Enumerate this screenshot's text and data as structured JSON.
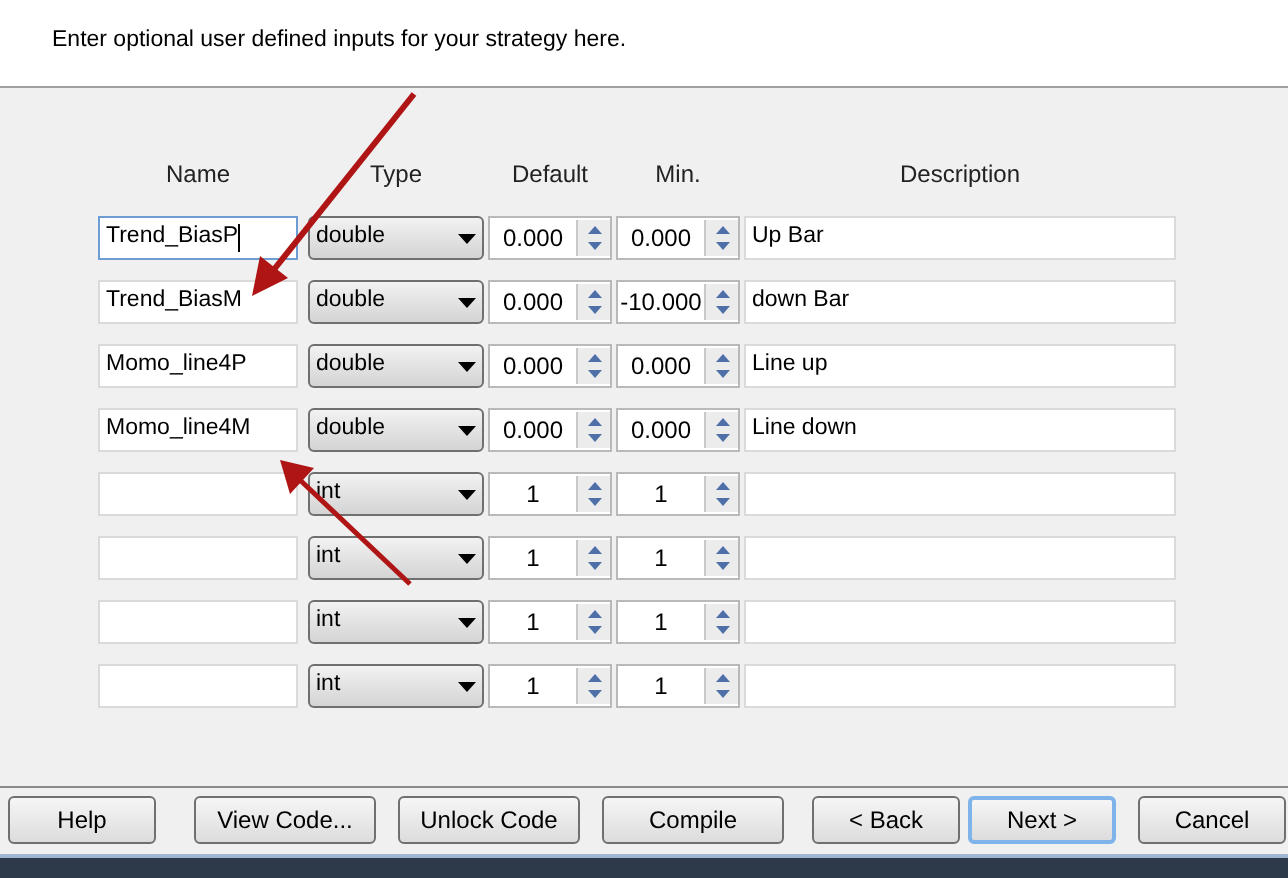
{
  "header": {
    "subtitle": "Enter optional user defined inputs for your strategy here."
  },
  "columns": {
    "name": "Name",
    "type": "Type",
    "default": "Default",
    "min": "Min.",
    "description": "Description"
  },
  "rows": [
    {
      "name": "Trend_BiasP",
      "focused": true,
      "type": "double",
      "default": "0.000",
      "min": "0.000",
      "description": "Up Bar"
    },
    {
      "name": "Trend_BiasM",
      "focused": false,
      "type": "double",
      "default": "0.000",
      "min": "-10.000",
      "description": "down Bar"
    },
    {
      "name": "Momo_line4P",
      "focused": false,
      "type": "double",
      "default": "0.000",
      "min": "0.000",
      "description": "Line up"
    },
    {
      "name": "Momo_line4M",
      "focused": false,
      "type": "double",
      "default": "0.000",
      "min": "0.000",
      "description": "Line down"
    },
    {
      "focused": false,
      "type": "int",
      "default": "1",
      "min": "1"
    },
    {
      "focused": false,
      "type": "int",
      "default": "1",
      "min": "1"
    },
    {
      "focused": false,
      "type": "int",
      "default": "1",
      "min": "1"
    },
    {
      "focused": false,
      "type": "int",
      "default": "1",
      "min": "1"
    }
  ],
  "buttons": [
    {
      "label": "Help",
      "default": false
    },
    {
      "label": "View Code...",
      "default": false
    },
    {
      "label": "Unlock Code",
      "default": false
    },
    {
      "label": "Compile",
      "default": false
    },
    {
      "label": "< Back",
      "default": false
    },
    {
      "label": "Next >",
      "default": true
    },
    {
      "label": "Cancel",
      "default": false
    }
  ]
}
